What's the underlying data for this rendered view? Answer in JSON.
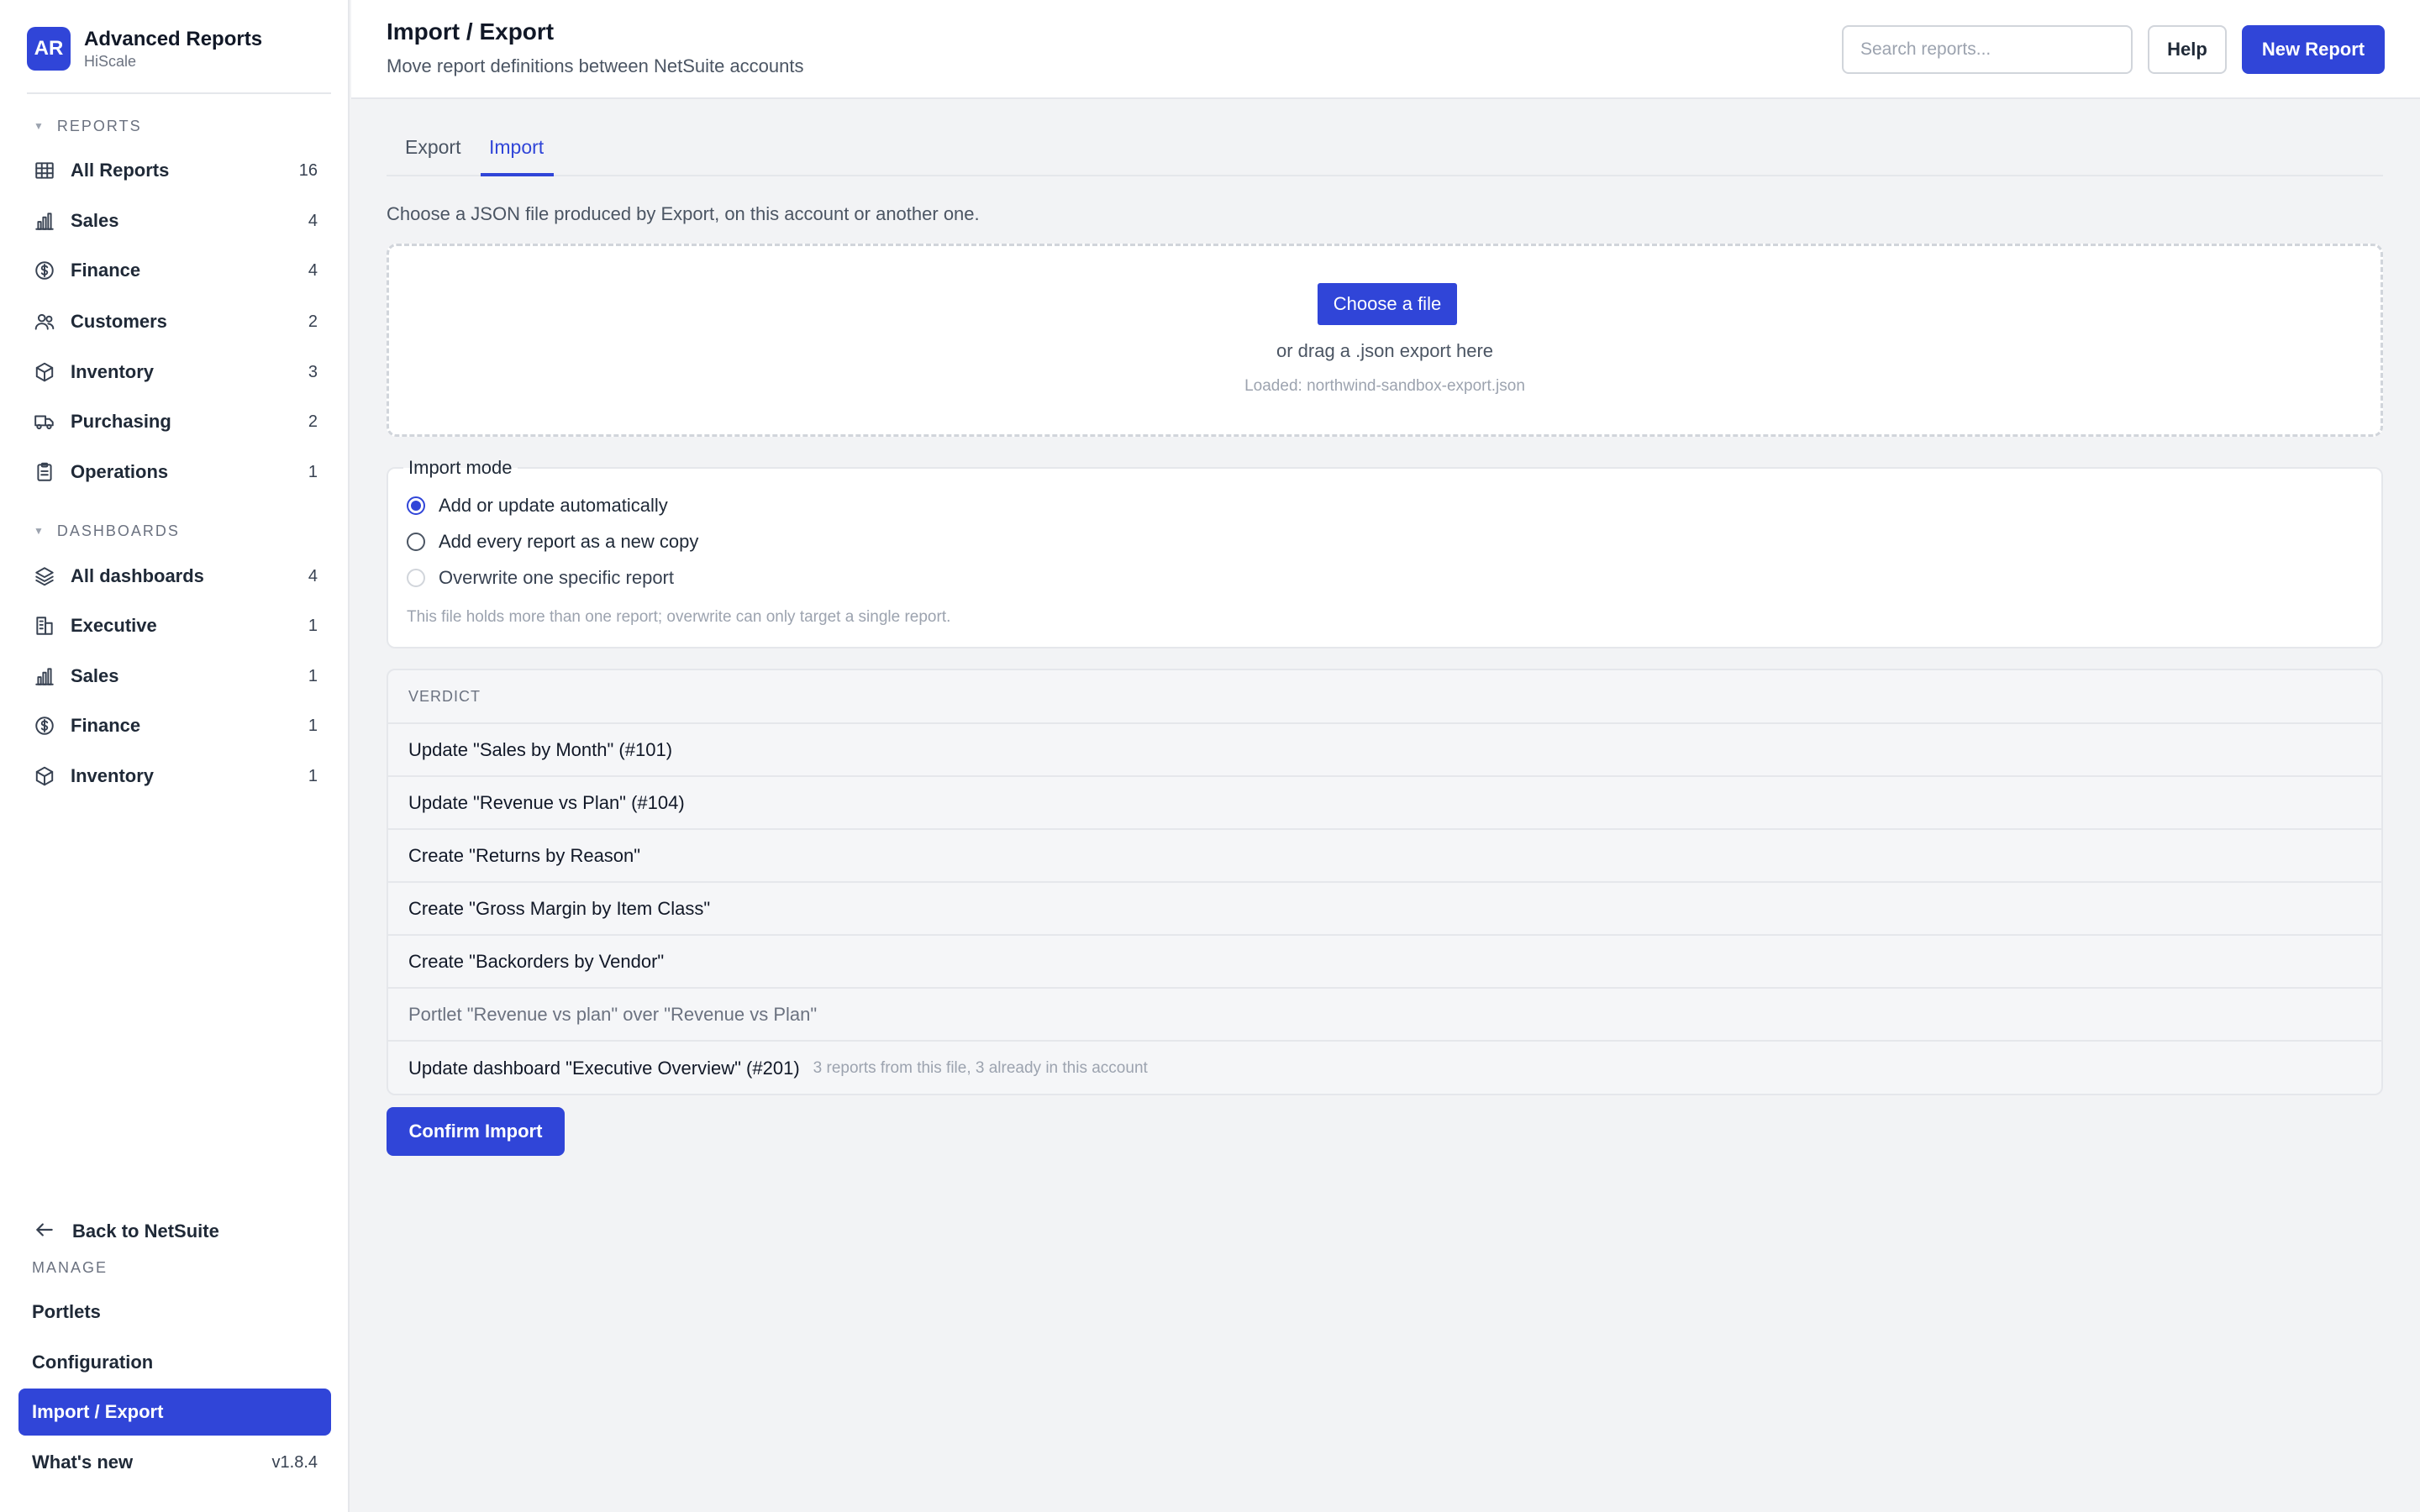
{
  "app": {
    "logo_initials": "AR",
    "title": "Advanced Reports",
    "subtitle": "HiScale"
  },
  "sidebar": {
    "reports_header": "REPORTS",
    "reports": [
      {
        "label": "All Reports",
        "count": "16",
        "icon": "table-icon"
      },
      {
        "label": "Sales",
        "count": "4",
        "icon": "bar-chart-icon"
      },
      {
        "label": "Finance",
        "count": "4",
        "icon": "dollar-circle-icon"
      },
      {
        "label": "Customers",
        "count": "2",
        "icon": "users-icon"
      },
      {
        "label": "Inventory",
        "count": "3",
        "icon": "box-icon"
      },
      {
        "label": "Purchasing",
        "count": "2",
        "icon": "truck-icon"
      },
      {
        "label": "Operations",
        "count": "1",
        "icon": "clipboard-icon"
      }
    ],
    "dashboards_header": "DASHBOARDS",
    "dashboards": [
      {
        "label": "All dashboards",
        "count": "4",
        "icon": "layers-icon"
      },
      {
        "label": "Executive",
        "count": "1",
        "icon": "building-icon"
      },
      {
        "label": "Sales",
        "count": "1",
        "icon": "bar-chart-icon"
      },
      {
        "label": "Finance",
        "count": "1",
        "icon": "dollar-circle-icon"
      },
      {
        "label": "Inventory",
        "count": "1",
        "icon": "box-icon"
      }
    ],
    "back_label": "Back to NetSuite",
    "manage_header": "MANAGE",
    "manage": [
      {
        "label": "Portlets",
        "meta": ""
      },
      {
        "label": "Configuration",
        "meta": ""
      },
      {
        "label": "Import / Export",
        "meta": "",
        "active": true
      },
      {
        "label": "What's new",
        "meta": "v1.8.4"
      }
    ]
  },
  "header": {
    "title": "Import / Export",
    "subtitle": "Move report definitions between NetSuite accounts",
    "search_placeholder": "Search reports...",
    "help_label": "Help",
    "new_report_label": "New Report"
  },
  "tabs": [
    {
      "label": "Export",
      "active": false
    },
    {
      "label": "Import",
      "active": true
    }
  ],
  "import": {
    "intro": "Choose a JSON file produced by Export, on this account or another one.",
    "choose_file_label": "Choose a file",
    "drop_hint": "or drag a .json export here",
    "loaded_text": "Loaded: northwind-sandbox-export.json",
    "mode_legend": "Import mode",
    "modes": [
      {
        "label": "Add or update automatically",
        "state": "checked"
      },
      {
        "label": "Add every report as a new copy",
        "state": "unchecked"
      },
      {
        "label": "Overwrite one specific report",
        "state": "disabled"
      }
    ],
    "mode_note": "This file holds more than one report; overwrite can only target a single report.",
    "verdict_header": "VERDICT",
    "verdict_rows": [
      {
        "text": "Update \"Sales by Month\" (#101)",
        "note": "",
        "muted": false
      },
      {
        "text": "Update \"Revenue vs Plan\" (#104)",
        "note": "",
        "muted": false
      },
      {
        "text": "Create \"Returns by Reason\"",
        "note": "",
        "muted": false
      },
      {
        "text": "Create \"Gross Margin by Item Class\"",
        "note": "",
        "muted": false
      },
      {
        "text": "Create \"Backorders by Vendor\"",
        "note": "",
        "muted": false
      },
      {
        "text": "Portlet \"Revenue vs plan\" over \"Revenue vs Plan\"",
        "note": "",
        "muted": true
      },
      {
        "text": "Update dashboard \"Executive Overview\" (#201)",
        "note": "3 reports from this file, 3 already in this account",
        "muted": false
      }
    ],
    "confirm_label": "Confirm Import"
  },
  "colors": {
    "accent": "#3045d8",
    "background": "#f2f3f5",
    "border": "#e5e7eb"
  }
}
